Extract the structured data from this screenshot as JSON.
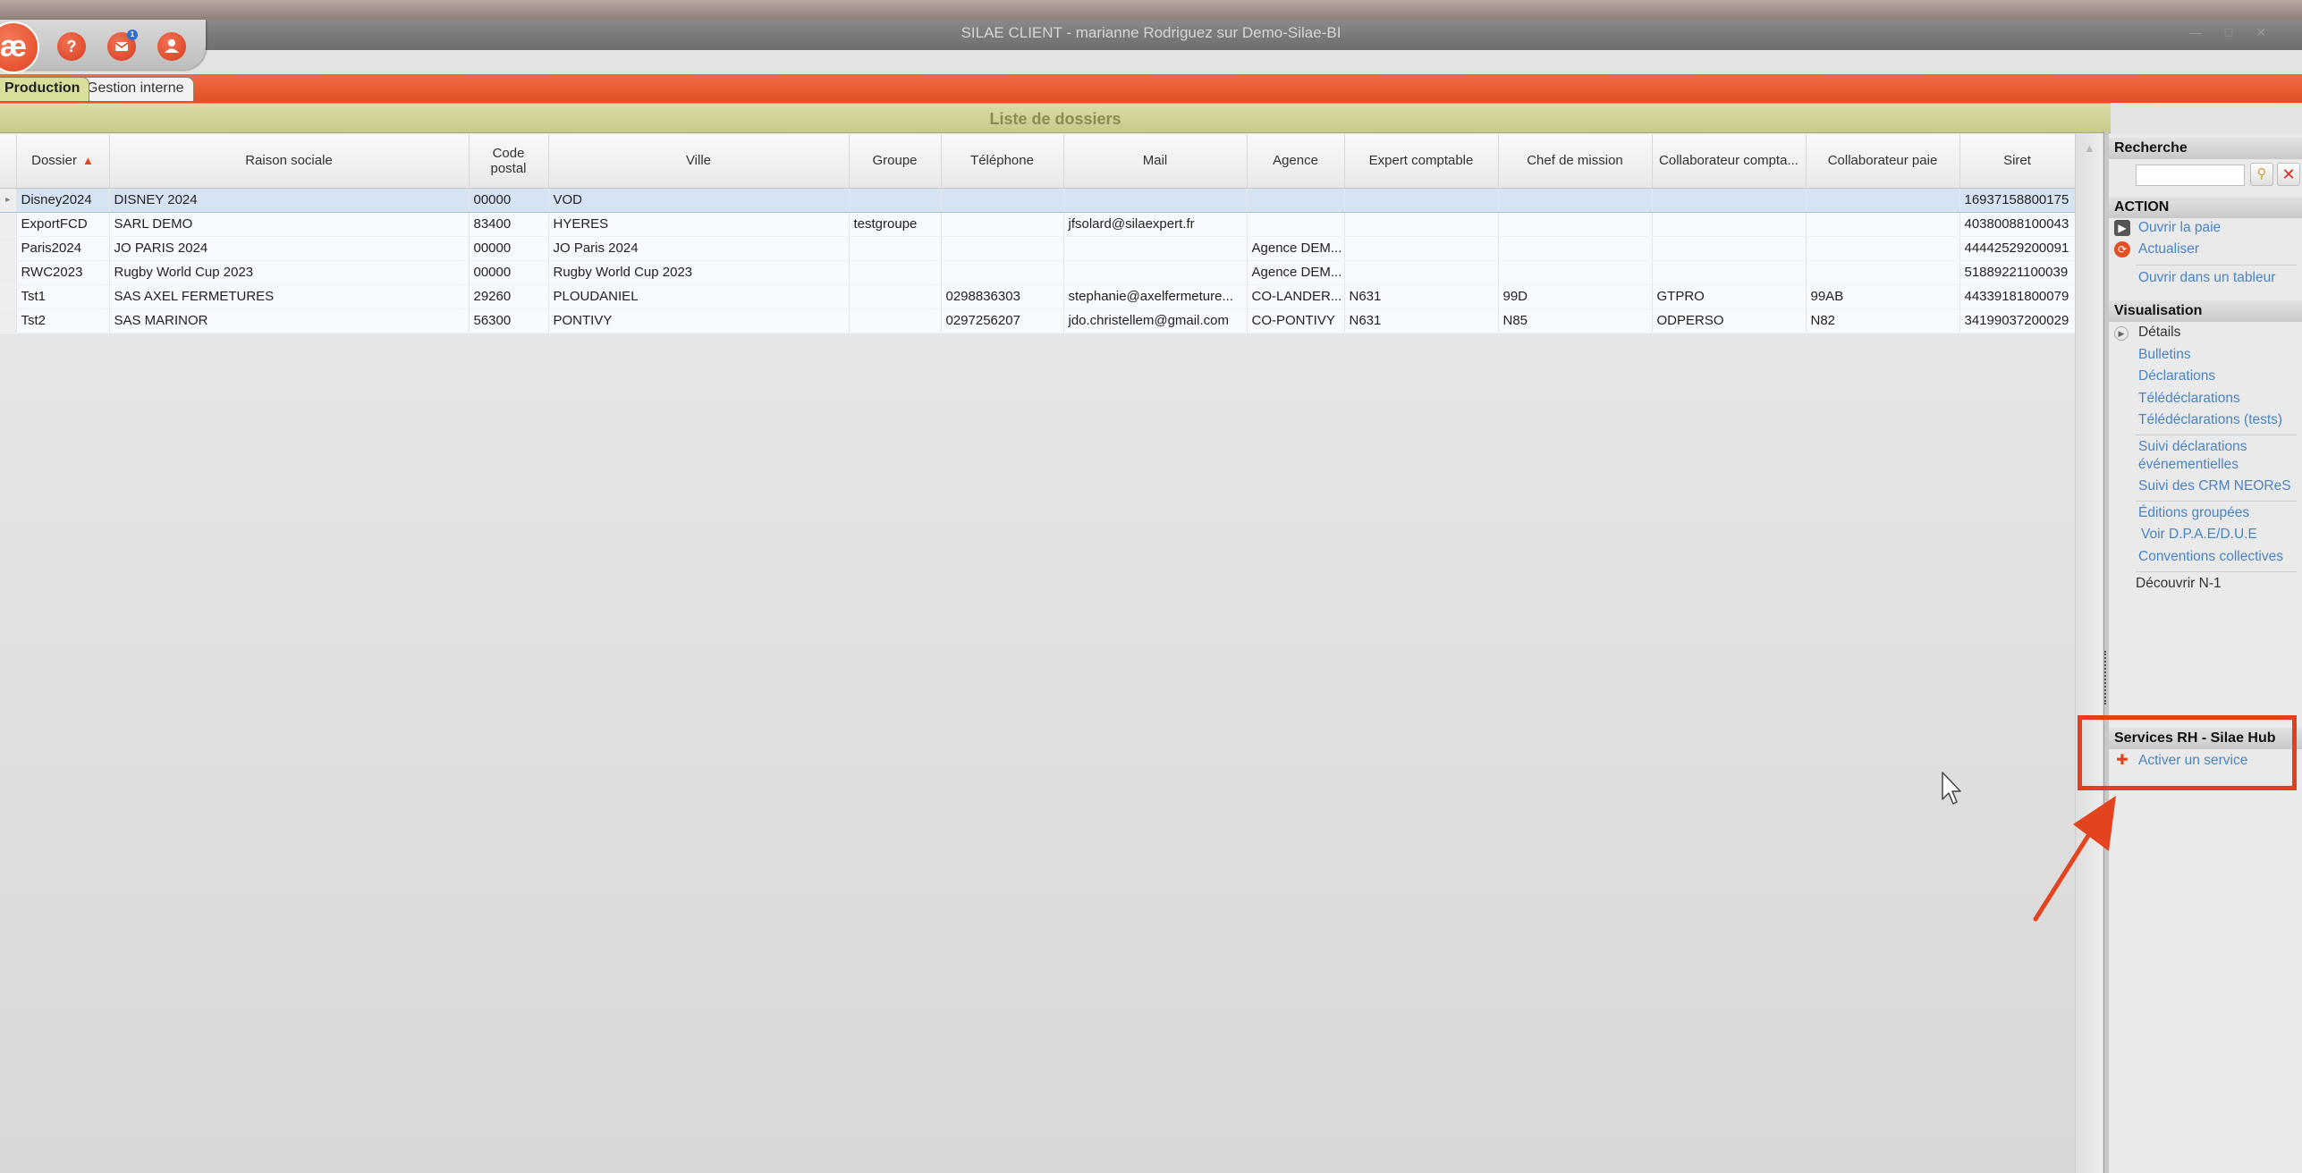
{
  "window": {
    "title": "SILAE CLIENT - marianne Rodriguez sur Demo-Silae-BI",
    "controls": [
      "—",
      "□",
      "✕"
    ]
  },
  "quick_toolbar": {
    "logo_text": "æ",
    "help_label": "?",
    "messages_badge": "1",
    "user_label": "👤"
  },
  "ribbon": {
    "tabs": [
      "Production",
      "Gestion interne"
    ]
  },
  "grid": {
    "caption": "Liste de dossiers",
    "columns": [
      "Dossier",
      "Raison sociale",
      "Code postal",
      "Ville",
      "Groupe",
      "Téléphone",
      "Mail",
      "Agence",
      "Expert comptable",
      "Chef de mission",
      "Collaborateur compta...",
      "Collaborateur paie",
      "Siret"
    ],
    "sort_indicator": "▲",
    "rows": [
      [
        "Disney2024",
        "DISNEY 2024",
        "00000",
        "VOD",
        "",
        "",
        "",
        "",
        "",
        "",
        "",
        "",
        "16937158800175"
      ],
      [
        "ExportFCD",
        "SARL DEMO",
        "83400",
        "HYERES",
        "testgroupe",
        "",
        "jfsolard@silaexpert.fr",
        "",
        "",
        "",
        "",
        "",
        "40380088100043"
      ],
      [
        "Paris2024",
        "JO PARIS 2024",
        "00000",
        "JO Paris 2024",
        "",
        "",
        "",
        "Agence DEM...",
        "",
        "",
        "",
        "",
        "44442529200091"
      ],
      [
        "RWC2023",
        "Rugby World Cup 2023",
        "00000",
        "Rugby World Cup 2023",
        "",
        "",
        "",
        "Agence DEM...",
        "",
        "",
        "",
        "",
        "51889221100039"
      ],
      [
        "Tst1",
        "SAS AXEL FERMETURES",
        "29260",
        "PLOUDANIEL",
        "",
        "0298836303",
        "stephanie@axelfermeture...",
        "CO-LANDER...",
        "N631",
        "99D",
        "GTPRO",
        "99AB",
        "44339181800079"
      ],
      [
        "Tst2",
        "SAS MARINOR",
        "56300",
        "PONTIVY",
        "",
        "0297256207",
        "jdo.christellem@gmail.com",
        "CO-PONTIVY",
        "N631",
        "N85",
        "ODPERSO",
        "N82",
        "34199037200029"
      ]
    ],
    "selected_row": 0
  },
  "panel": {
    "search_title": "Recherche",
    "action_title": "ACTION",
    "actions": [
      "Ouvrir la paie",
      "Actualiser",
      "Ouvrir dans un tableur"
    ],
    "visualisation_title": "Visualisation",
    "details_label": "Détails",
    "vis_links": [
      "Bulletins",
      "Déclarations",
      "Télédéclarations",
      "Télédéclarations (tests)"
    ],
    "vis_links2": [
      "Suivi déclarations",
      "événementielles",
      "Suivi des CRM NEOReS"
    ],
    "vis_links3": [
      "Éditions groupées",
      "Voir D.P.A.E/D.U.E",
      "Conventions collectives"
    ],
    "decouvrir_label": "Découvrir N-1",
    "services_title": "Services RH - Silae Hub",
    "service_link": "Activer un service"
  },
  "colors": {
    "accent": "#E4431F",
    "link": "#4A84C4",
    "caption_band": "#D3D59A"
  },
  "icons": [
    "logo-icon",
    "help-icon",
    "messages-icon",
    "user-icon",
    "search-icon",
    "clear-icon",
    "open-payroll-icon",
    "refresh-icon",
    "details-icon",
    "puzzle-icon",
    "cursor-icon"
  ]
}
